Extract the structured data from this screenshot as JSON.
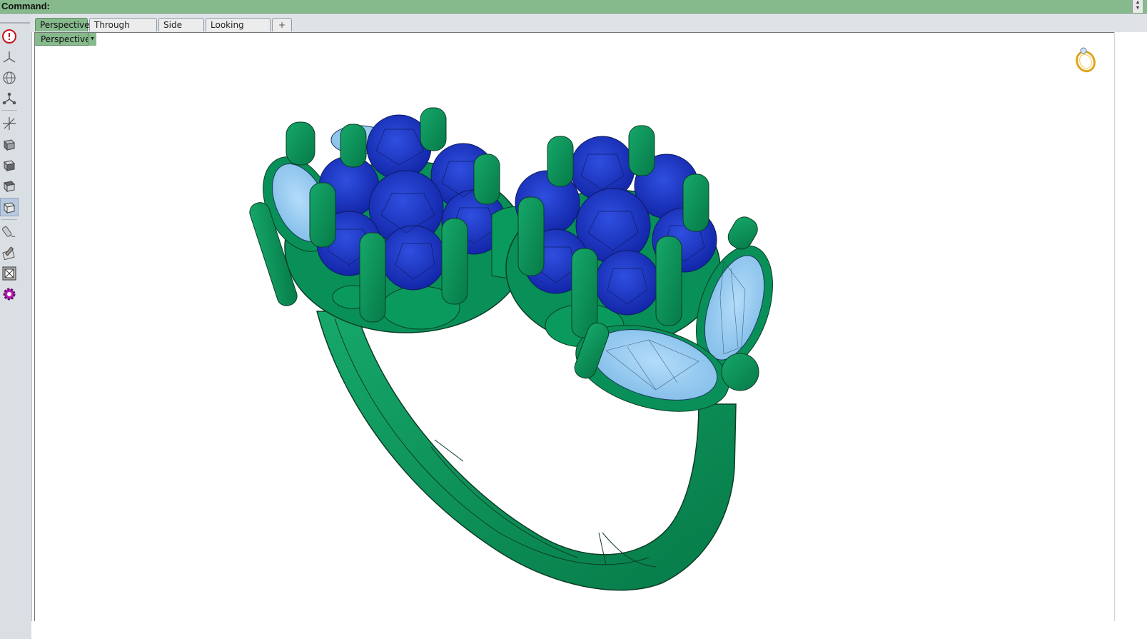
{
  "command_bar": {
    "label": "Command:"
  },
  "tabs": [
    {
      "label": "Perspective",
      "active": true
    },
    {
      "label": "Through Finger",
      "active": false
    },
    {
      "label": "Side View",
      "active": false
    },
    {
      "label": "Looking Down",
      "active": false
    },
    {
      "label": "+",
      "active": false
    }
  ],
  "viewport": {
    "title": "Perspective"
  },
  "toolbar": {
    "tools": [
      {
        "icon": "power-icon"
      },
      {
        "icon": "axes-icon"
      },
      {
        "icon": "globe-icon"
      },
      {
        "icon": "nodes-icon"
      },
      {
        "icon": "move-axes-icon"
      },
      {
        "icon": "box-front-icon"
      },
      {
        "icon": "box-side-icon"
      },
      {
        "icon": "box-top-icon"
      },
      {
        "icon": "box-iso-icon"
      },
      {
        "icon": "pen-icon"
      },
      {
        "icon": "pencil-grid-icon"
      },
      {
        "icon": "zoom-extents-icon"
      },
      {
        "icon": "settings-gear-icon"
      }
    ]
  },
  "colors": {
    "accent_green": "#86b98c",
    "metal_green": "#0a9a5e",
    "stone_blue": "#1d36c8",
    "stone_light": "#9ec9f2"
  }
}
